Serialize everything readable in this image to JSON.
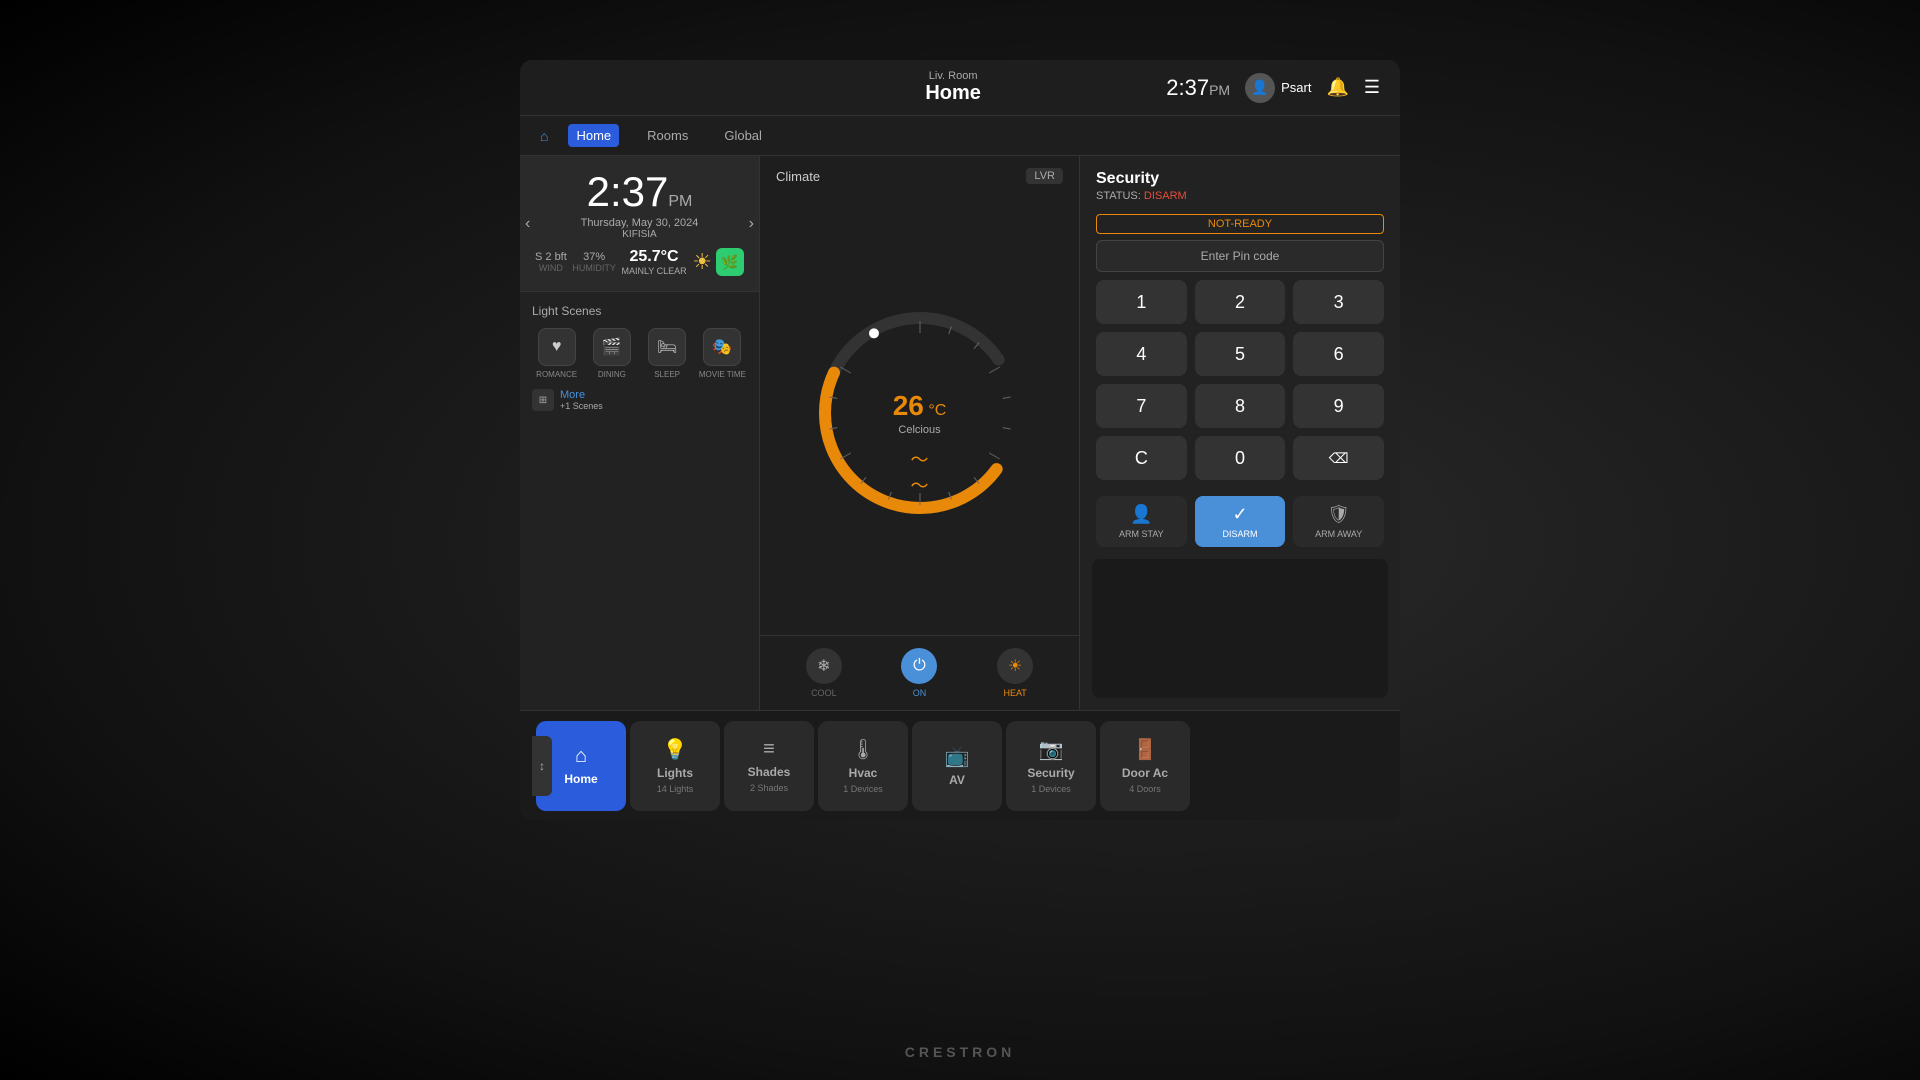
{
  "header": {
    "location_sub": "Liv. Room",
    "location_main": "Home",
    "time": "2:37",
    "time_period": "PM",
    "user_name": "Psart",
    "nav_tabs": [
      {
        "label": "Home",
        "active": true
      },
      {
        "label": "Rooms",
        "active": false
      },
      {
        "label": "Global",
        "active": false
      }
    ]
  },
  "clock": {
    "time": "2:37",
    "period": "PM",
    "date": "Thursday, May 30, 2024",
    "city": "KIFISIA",
    "wind_label": "WIND",
    "wind_val": "S 2 bft",
    "humidity_label": "HUMIDITY",
    "humidity_val": "37%",
    "temp": "25.7°C",
    "desc": "MAINLY CLEAR"
  },
  "light_scenes": {
    "title": "Light Scenes",
    "scenes": [
      {
        "label": "ROMANCE",
        "icon": "♥"
      },
      {
        "label": "DINING",
        "icon": "🎬"
      },
      {
        "label": "SLEEP",
        "icon": "🛏"
      },
      {
        "label": "MOVIE TIME",
        "icon": "🎭"
      }
    ],
    "more_label": "More",
    "more_sub": "+1 Scenes"
  },
  "climate": {
    "title": "Climate",
    "room": "LVR",
    "temp_value": "26",
    "temp_unit": "°C",
    "temp_label": "Celcious",
    "controls": [
      {
        "label": "COOL",
        "active": false,
        "icon": "❄"
      },
      {
        "label": "ON",
        "active": true,
        "icon": "⏻"
      },
      {
        "label": "HEAT",
        "active": false,
        "icon": "☀"
      }
    ]
  },
  "security": {
    "title": "Security",
    "status_label": "STATUS:",
    "status_value": "DISARM",
    "not_ready": "NOT-READY",
    "pin_placeholder": "Enter Pin code",
    "keys": [
      "1",
      "2",
      "3",
      "4",
      "5",
      "6",
      "7",
      "8",
      "9",
      "C",
      "0",
      "⌫"
    ],
    "actions": [
      {
        "label": "ARM STAY",
        "icon": "👤",
        "active": false
      },
      {
        "label": "DISARM",
        "icon": "✓",
        "active": true
      },
      {
        "label": "ARM AWAY",
        "icon": "🛡",
        "active": false
      }
    ]
  },
  "bottom_nav": [
    {
      "label": "Home",
      "icon": "⌂",
      "sub": "",
      "active": true
    },
    {
      "label": "Lights",
      "icon": "💡",
      "sub": "14 Lights",
      "active": false
    },
    {
      "label": "Shades",
      "icon": "≡",
      "sub": "2 Shades",
      "active": false
    },
    {
      "label": "Hvac",
      "icon": "🌡",
      "sub": "1 Devices",
      "active": false
    },
    {
      "label": "AV",
      "icon": "📺",
      "sub": "",
      "active": false
    },
    {
      "label": "Security",
      "icon": "📷",
      "sub": "1 Devices",
      "active": false
    },
    {
      "label": "Door Ac",
      "icon": "🚪",
      "sub": "4 Doors",
      "active": false
    }
  ],
  "brand": "CRESTRON"
}
